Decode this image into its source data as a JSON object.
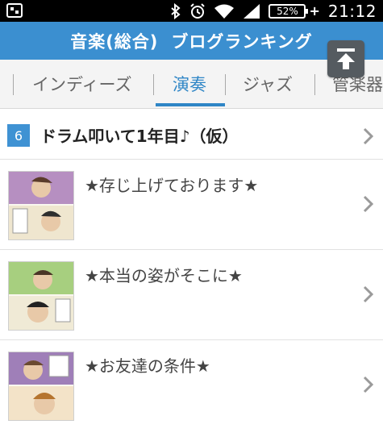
{
  "status_bar": {
    "battery": "52%",
    "time": "21:12",
    "icons": [
      "app-icon",
      "bluetooth-icon",
      "alarm-icon",
      "wifi-icon",
      "signal-icon",
      "battery-icon"
    ]
  },
  "header": {
    "title_part1": "音楽(総合)",
    "title_part2": "ブログランキング"
  },
  "tabs": [
    {
      "label": "インディーズ",
      "active": false
    },
    {
      "label": "演奏",
      "active": true
    },
    {
      "label": "ジャズ",
      "active": false
    },
    {
      "label": "管楽器",
      "active": false
    }
  ],
  "ranking": {
    "rank": "6",
    "blog_title": "ドラム叩いて1年目♪（仮）"
  },
  "posts": [
    {
      "title": "★存じ上げております★"
    },
    {
      "title": "★本当の姿がそこに★"
    },
    {
      "title": "★お友達の条件★"
    }
  ],
  "colors": {
    "header_bg": "#3b8fd0",
    "accent": "#2f86c6",
    "badge_bg": "#3f92d3"
  }
}
